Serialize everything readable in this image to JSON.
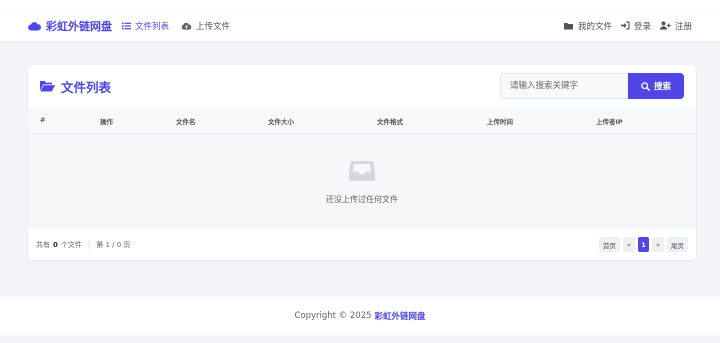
{
  "brand": {
    "name": "彩虹外链网盘",
    "icon": "cloud-icon"
  },
  "nav_left": [
    {
      "label": "文件列表",
      "icon": "list-icon",
      "active": true
    },
    {
      "label": "上传文件",
      "icon": "cloud-upload-icon",
      "active": false
    }
  ],
  "nav_right": [
    {
      "label": "我的文件",
      "icon": "folder-icon"
    },
    {
      "label": "登录",
      "icon": "sign-in-icon"
    },
    {
      "label": "注册",
      "icon": "user-plus-icon"
    }
  ],
  "page": {
    "title": "文件列表",
    "icon": "folder-open-icon"
  },
  "search": {
    "placeholder": "请输入搜索关键字",
    "button_label": "搜索",
    "icon": "search-icon"
  },
  "table": {
    "columns": [
      "#",
      "操作",
      "文件名",
      "文件大小",
      "文件格式",
      "上传时间",
      "上传者IP"
    ],
    "empty_text": "还没上传过任何文件",
    "empty_icon": "inbox-icon"
  },
  "summary": {
    "prefix": "共有",
    "count": "0",
    "unit": "个文件",
    "page_info": "第 1 / 0 页"
  },
  "pagination": {
    "first": "首页",
    "prev": "«",
    "current": "1",
    "next": "»",
    "last": "尾页"
  },
  "footer": {
    "text": "Copyright © 2025",
    "brand": "彩虹外链网盘"
  },
  "colors": {
    "accent": "#4f46e5"
  }
}
